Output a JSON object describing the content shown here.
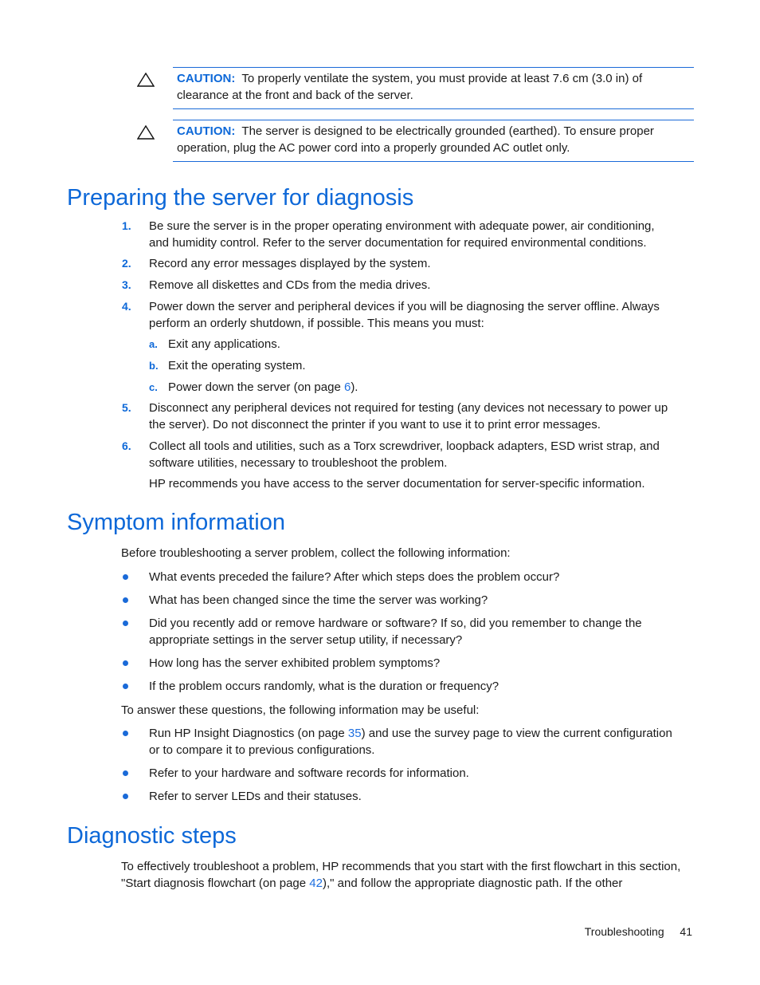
{
  "cautions": [
    {
      "label": "CAUTION:",
      "line1": "To properly ventilate the system, you must provide at least 7.6 cm (3.0 in) of",
      "line2": "clearance at the front and back of the server.",
      "icon": "warning-triangle-icon"
    },
    {
      "label": "CAUTION:",
      "line1": "The server is designed to be electrically grounded (earthed). To ensure proper",
      "line2": "operation, plug the AC power cord into a properly grounded AC outlet only.",
      "icon": "warning-triangle-icon"
    }
  ],
  "sections": {
    "preparing": {
      "title": "Preparing the server for diagnosis",
      "steps": [
        {
          "num": "1.",
          "lines": [
            "Be sure the server is in the proper operating environment with adequate power, air conditioning,",
            "and humidity control. Refer to the server documentation for required environmental conditions."
          ]
        },
        {
          "num": "2.",
          "lines": [
            "Record any error messages displayed by the system."
          ]
        },
        {
          "num": "3.",
          "lines": [
            "Remove all diskettes and CDs from the media drives."
          ]
        },
        {
          "num": "4.",
          "lines": [
            "Power down the server and peripheral devices if you will be diagnosing the server offline. Always",
            "perform an orderly shutdown, if possible. This means you must:"
          ],
          "substeps": [
            {
              "letter": "a.",
              "text": "Exit any applications."
            },
            {
              "letter": "b.",
              "text": "Exit the operating system."
            },
            {
              "letter": "c.",
              "text_before": "Power down the server (on page ",
              "link": "6",
              "text_after": ")."
            }
          ]
        },
        {
          "num": "5.",
          "lines": [
            "Disconnect any peripheral devices not required for testing (any devices not necessary to power up",
            "the server). Do not disconnect the printer if you want to use it to print error messages."
          ]
        },
        {
          "num": "6.",
          "lines": [
            "Collect all tools and utilities, such as a Torx screwdriver, loopback adapters, ESD wrist strap, and",
            "software utilities, necessary to troubleshoot the problem."
          ]
        }
      ],
      "note": "HP recommends you have access to the server documentation for server-specific information."
    },
    "symptom": {
      "title": "Symptom information",
      "intro": "Before troubleshooting a server problem, collect the following information:",
      "bullets": [
        [
          "What events preceded the failure? After which steps does the problem occur?"
        ],
        [
          "What has been changed since the time the server was working?"
        ],
        [
          "Did you recently add or remove hardware or software? If so, did you remember to change the",
          "appropriate settings in the server setup utility, if necessary?"
        ],
        [
          "How long has the server exhibited problem symptoms?"
        ],
        [
          "If the problem occurs randomly, what is the duration or frequency?"
        ]
      ],
      "intro2": "To answer these questions, the following information may be useful:",
      "bullets2": [
        {
          "before": "Run HP Insight Diagnostics (on page ",
          "link": "35",
          "after": ") and use the survey page to view the current configuration",
          "line2": "or to compare it to previous configurations."
        },
        {
          "before": "Refer to your hardware and software records for information."
        },
        {
          "before": "Refer to server LEDs and their statuses."
        }
      ]
    },
    "diagnostic": {
      "title": "Diagnostic steps",
      "line1": "To effectively troubleshoot a problem, HP recommends that you start with the first flowchart in this section,",
      "line2_before": "\"Start diagnosis flowchart (on page ",
      "line2_link": "42",
      "line2_after": "),\" and follow the appropriate diagnostic path. If the other"
    }
  },
  "footer": {
    "section": "Troubleshooting",
    "page": "41"
  }
}
